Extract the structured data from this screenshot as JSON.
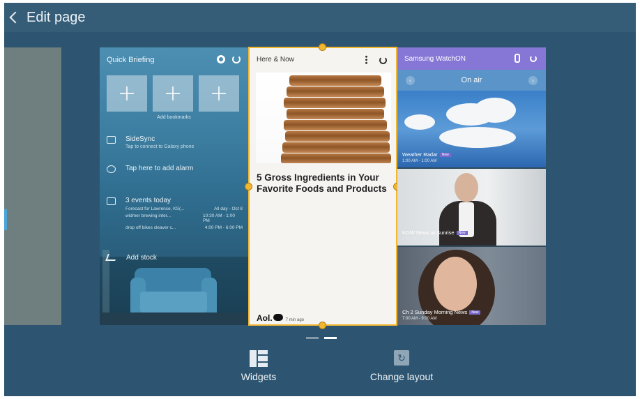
{
  "header": {
    "title": "Edit page"
  },
  "quick_briefing": {
    "title": "Quick Briefing",
    "add_bookmarks_label": "Add bookmarks",
    "sidesync_title": "SideSync",
    "sidesync_sub": "Tap to connect to Galaxy phone",
    "alarm_label": "Tap here to add alarm",
    "events_title": "3 events today",
    "events": [
      {
        "name": "Forecast for Lawrence, KS(...",
        "time": "All day - Oct 8"
      },
      {
        "name": "widmer brewing inter...",
        "time": "10:30 AM - 1:00 PM"
      },
      {
        "name": "drop off bikes cleaver c...",
        "time": "4:00 PM - 6:00 PM"
      }
    ],
    "stock_label": "Add stock"
  },
  "here_now": {
    "title": "Here & Now",
    "headline": "5 Gross Ingredients in Your Favorite Foods and Products",
    "source": "Aol.",
    "time": "7 min ago"
  },
  "watchon": {
    "title": "Samsung WatchON",
    "on_air_label": "On air",
    "shows": [
      {
        "name": "Weather Radar",
        "tag": "New",
        "time": "1:00 AM - 1:00 AM"
      },
      {
        "name": "KGW News at Sunrise",
        "tag": "New",
        "time": "6:00 AM - 9:00 AM"
      },
      {
        "name": "Ch 2 Sunday Morning News",
        "tag": "New",
        "time": "7:00 AM - 9:00 AM"
      }
    ]
  },
  "pager": {
    "pages": 2,
    "active_index": 1
  },
  "bottom": {
    "widgets_label": "Widgets",
    "change_layout_label": "Change layout"
  },
  "colors": {
    "background": "#2d5571",
    "accent": "#f2b731",
    "watchon_header": "#8676d6"
  }
}
